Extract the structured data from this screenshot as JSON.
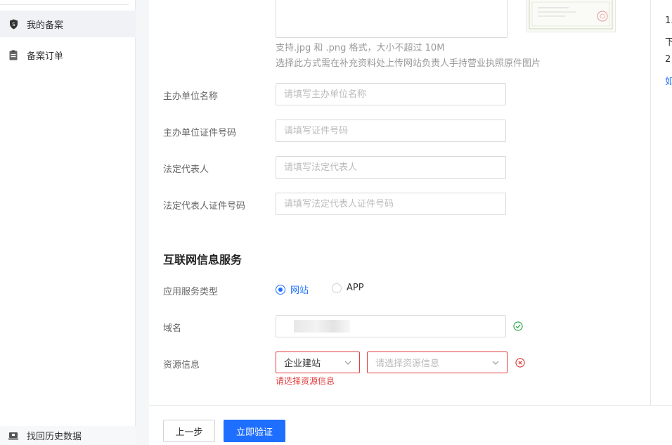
{
  "sidebar": {
    "items": [
      {
        "label": "我的备案",
        "icon": "shield-icon"
      },
      {
        "label": "备案订单",
        "icon": "clipboard-icon"
      }
    ],
    "bottom_item": {
      "label": "找回历史数据",
      "icon": "history-icon"
    }
  },
  "right_panel": {
    "line1": "1.",
    "line2": "下",
    "line3": "2",
    "line4_link": "如"
  },
  "upload": {
    "hint_format": "支持.jpg 和 .png 格式，大小不超过 10M",
    "hint_note": "选择此方式需在补充资料处上传网站负责人手持营业执照原件图片"
  },
  "form": {
    "org_name": {
      "label": "主办单位名称",
      "placeholder": "请填写主办单位名称",
      "value": ""
    },
    "org_id": {
      "label": "主办单位证件号码",
      "placeholder": "请填写证件号码",
      "value": ""
    },
    "legal_rep": {
      "label": "法定代表人",
      "placeholder": "请填写法定代表人",
      "value": ""
    },
    "legal_rep_id": {
      "label": "法定代表人证件号码",
      "placeholder": "请填写法定代表人证件号码",
      "value": ""
    }
  },
  "internet_service": {
    "title": "互联网信息服务",
    "service_type": {
      "label": "应用服务类型",
      "options": [
        "网站",
        "APP"
      ],
      "selected": "网站"
    },
    "domain": {
      "label": "域名",
      "value": ""
    },
    "resource": {
      "label": "资源信息",
      "type_value": "企业建站",
      "detail_placeholder": "请选择资源信息",
      "error": "请选择资源信息"
    }
  },
  "footer": {
    "prev_label": "上一步",
    "verify_label": "立即验证"
  },
  "colors": {
    "primary": "#1e6fff",
    "error": "#e03e3e",
    "success": "#2ea84a"
  }
}
